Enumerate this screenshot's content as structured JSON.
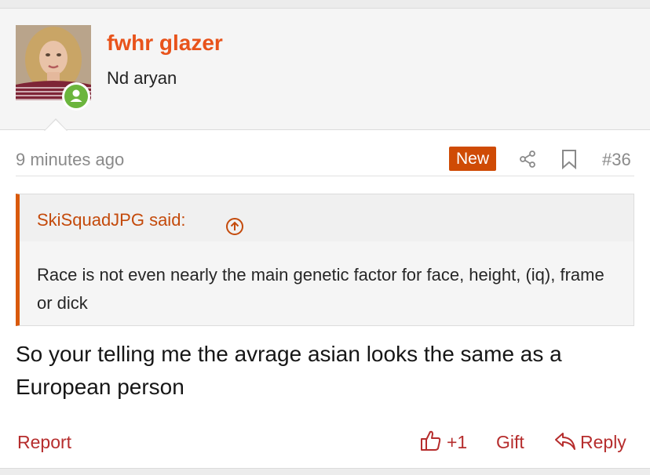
{
  "user": {
    "name": "fwhr glazer",
    "title": "Nd aryan",
    "avatar_icon": "avatar-photo",
    "status_icon": "online-user-icon",
    "status_color": "#6bb53d"
  },
  "post": {
    "timestamp": "9 minutes ago",
    "new_badge": "New",
    "new_badge_color": "#cf4b05",
    "number": "#36",
    "share_icon": "share-icon",
    "bookmark_icon": "bookmark-icon",
    "quote": {
      "author": "SkiSquadJPG said:",
      "jump_icon": "arrow-up-circle-icon",
      "text": "Race is not even nearly the main genetic factor for face, height, (iq), frame or dick"
    },
    "message": "So your telling me the avrage asian looks the same as a European person"
  },
  "actions": {
    "report": "Report",
    "like_count": "+1",
    "like_icon": "thumbs-up-icon",
    "gift": "Gift",
    "reply": "Reply",
    "reply_icon": "reply-arrow-icon"
  },
  "colors": {
    "accent": "#e8531b",
    "link": "#b62d2d",
    "quote_border": "#d9590c"
  }
}
